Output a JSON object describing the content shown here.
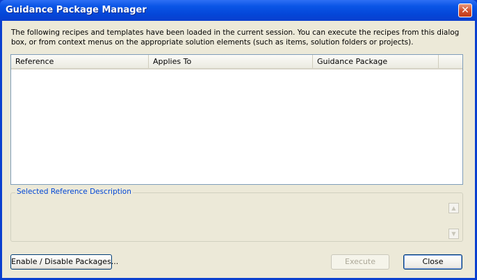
{
  "window": {
    "title": "Guidance Package Manager",
    "close_glyph": "✕"
  },
  "description": "The following recipes and templates have been loaded in the current session. You can execute the recipes from this dialog box, or from context menus on the appropriate solution elements (such as items, solution folders or projects).",
  "list": {
    "columns": [
      "Reference",
      "Applies To",
      "Guidance Package"
    ],
    "rows": []
  },
  "details": {
    "label": "Selected Reference Description",
    "text": "",
    "scroll_up": "▲",
    "scroll_down": "▼"
  },
  "buttons": {
    "enable_disable": "Enable / Disable Packages...",
    "execute": "Execute",
    "close": "Close"
  }
}
